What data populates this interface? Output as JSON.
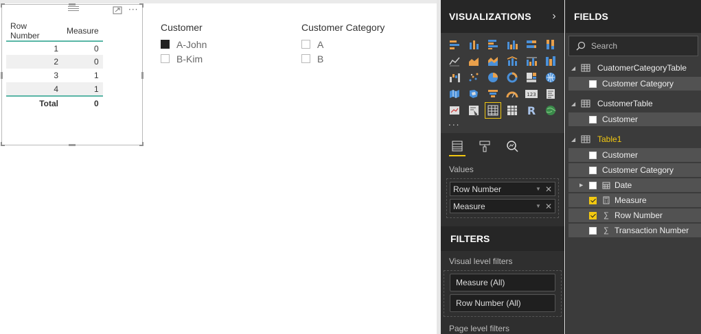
{
  "table_visual": {
    "columns": [
      "Row Number",
      "Measure"
    ],
    "rows": [
      {
        "row_number": "1",
        "measure": "0"
      },
      {
        "row_number": "2",
        "measure": "0"
      },
      {
        "row_number": "3",
        "measure": "1"
      },
      {
        "row_number": "4",
        "measure": "1"
      }
    ],
    "total_label": "Total",
    "total_value": "0"
  },
  "slicer_customer": {
    "title": "Customer",
    "options": [
      {
        "label": "A-John",
        "checked": true
      },
      {
        "label": "B-Kim",
        "checked": false
      }
    ]
  },
  "slicer_category": {
    "title": "Customer Category",
    "options": [
      {
        "label": "A",
        "checked": false
      },
      {
        "label": "B",
        "checked": false
      }
    ]
  },
  "visualizations": {
    "title": "VISUALIZATIONS",
    "more": "...",
    "values_label": "Values",
    "wells": [
      "Row Number",
      "Measure"
    ],
    "icons": [
      "stacked-bar-chart",
      "stacked-column-chart",
      "clustered-bar-chart",
      "clustered-column-chart",
      "100-stacked-bar-chart",
      "100-stacked-column-chart",
      "line-chart",
      "area-chart",
      "stacked-area-chart",
      "line-and-stacked-column-chart",
      "line-and-clustered-column-chart",
      "ribbon-chart",
      "waterfall-chart",
      "scatter-chart",
      "pie-chart",
      "donut-chart",
      "treemap",
      "map",
      "filled-map",
      "shape-map",
      "funnel-chart",
      "gauge",
      "card",
      "multi-row-card",
      "kpi",
      "slicer",
      "table",
      "matrix",
      "r-visual",
      "arcgis-map"
    ],
    "r_letter": "R",
    "card_label": "123"
  },
  "filters": {
    "title": "FILTERS",
    "visual_level_label": "Visual level filters",
    "visual_filters": [
      "Measure (All)",
      "Row Number (All)"
    ],
    "page_level_label": "Page level filters"
  },
  "fields": {
    "title": "FIELDS",
    "search_placeholder": "Search",
    "tables": [
      {
        "name": "CuatomerCategoryTable",
        "highlight": false,
        "fields": [
          {
            "name": "Customer Category",
            "checked": false,
            "icon": ""
          }
        ]
      },
      {
        "name": "CustomerTable",
        "highlight": false,
        "fields": [
          {
            "name": "Customer",
            "checked": false,
            "icon": ""
          }
        ]
      },
      {
        "name": "Table1",
        "highlight": true,
        "fields": [
          {
            "name": "Customer",
            "checked": false,
            "icon": ""
          },
          {
            "name": "Customer Category",
            "checked": false,
            "icon": ""
          },
          {
            "name": "Date",
            "checked": false,
            "icon": "calendar"
          },
          {
            "name": "Measure",
            "checked": true,
            "icon": "calculator"
          },
          {
            "name": "Row Number",
            "checked": true,
            "icon": "sigma"
          },
          {
            "name": "Transaction Number",
            "checked": false,
            "icon": "sigma"
          }
        ]
      }
    ]
  },
  "colors": {
    "accent": "#f2c811",
    "table_rule": "#58b5a5",
    "pane_bg": "#2f2f2f"
  }
}
